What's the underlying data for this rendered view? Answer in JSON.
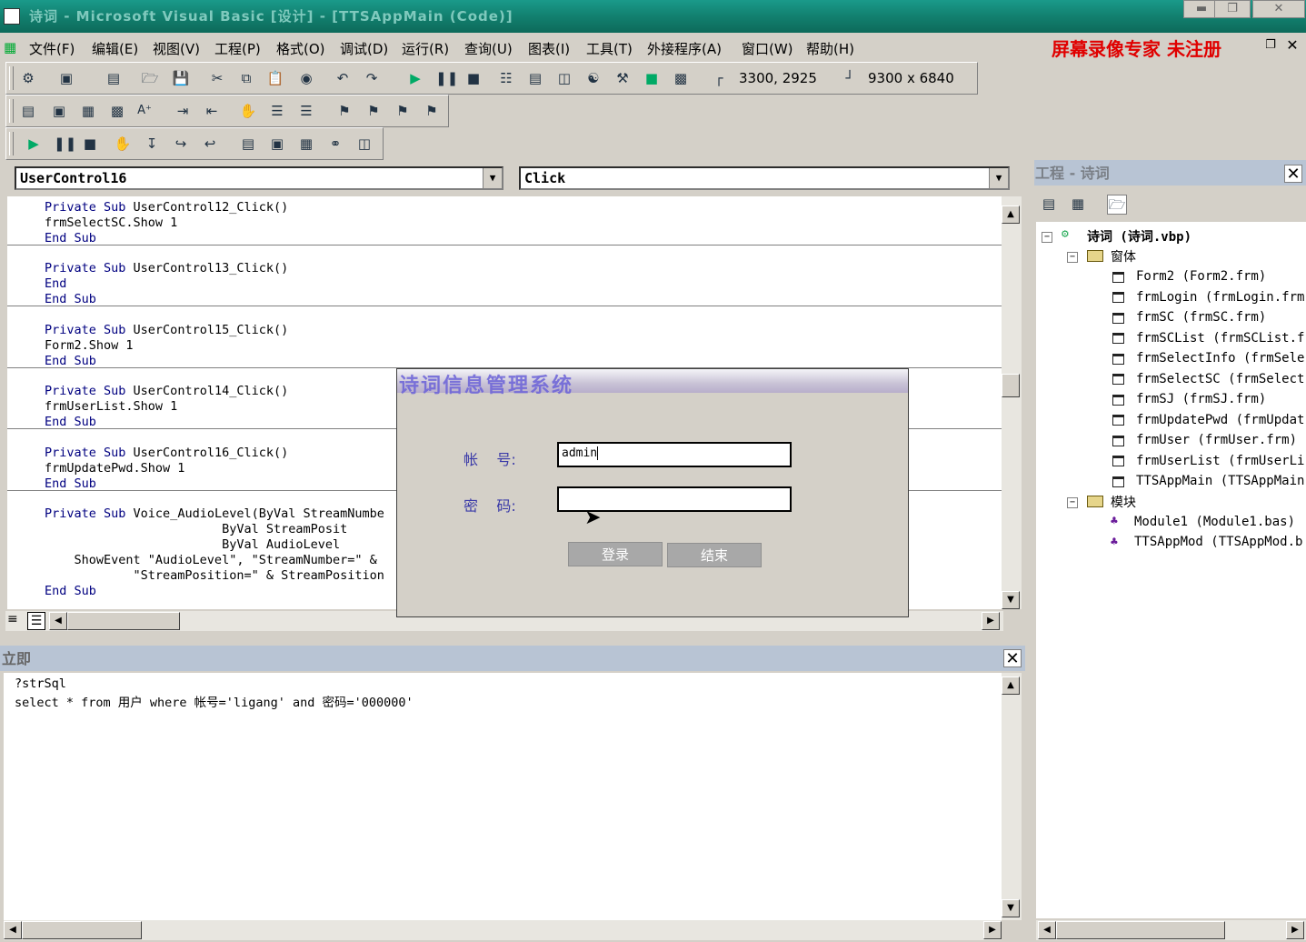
{
  "window": {
    "title": "诗词 - Microsoft Visual Basic [设计] - [TTSAppMain (Code)]",
    "min_icon": "minimize-icon",
    "max_icon": "restore-icon",
    "close_icon": "close-icon"
  },
  "menu": {
    "items": [
      "文件(F)",
      "编辑(E)",
      "视图(V)",
      "工程(P)",
      "格式(O)",
      "调试(D)",
      "运行(R)",
      "查询(U)",
      "图表(I)",
      "工具(T)",
      "外接程序(A)",
      "窗口(W)",
      "帮助(H)"
    ],
    "recorder_label": "屏幕录像专家  未注册"
  },
  "toolbar": {
    "position": "3300, 2925",
    "size": "9300 x 6840"
  },
  "code": {
    "object_combo": "UserControl16",
    "proc_combo": "Click",
    "lines": [
      [
        "Private Sub ",
        "UserControl12_Click()"
      ],
      [
        "",
        "frmSelectSC.Show 1"
      ],
      [
        "End Sub",
        ""
      ],
      [
        "Private Sub ",
        "UserControl13_Click()"
      ],
      [
        "End",
        ""
      ],
      [
        "End Sub",
        ""
      ],
      [
        "Private Sub ",
        "UserControl15_Click()"
      ],
      [
        "",
        "Form2.Show 1"
      ],
      [
        "End Sub",
        ""
      ],
      [
        "Private Sub ",
        "UserControl14_Click()"
      ],
      [
        "",
        "frmUserList.Show 1"
      ],
      [
        "End Sub",
        ""
      ],
      [
        "Private Sub ",
        "UserControl16_Click()"
      ],
      [
        "",
        "frmUpdatePwd.Show 1"
      ],
      [
        "End Sub",
        ""
      ],
      [
        "Private Sub ",
        "Voice_AudioLevel(ByVal StreamNumbe"
      ],
      [
        "",
        "                        ByVal StreamPosit"
      ],
      [
        "",
        "                        ByVal AudioLevel"
      ],
      [
        "",
        "    ShowEvent \"AudioLevel\", \"StreamNumber=\" &"
      ],
      [
        "",
        "            \"StreamPosition=\" & StreamPosition"
      ],
      [
        "End Sub",
        ""
      ]
    ]
  },
  "dialog": {
    "title": "诗词信息管理系统",
    "account_label": "帐    号:",
    "account_value": "admin",
    "password_label": "密    码:",
    "password_value": "",
    "login_button": "登录",
    "exit_button": "结束"
  },
  "immediate": {
    "title": "立即",
    "lines": [
      "?strSql",
      "select * from 用户 where 帐号='ligang' and 密码='000000'"
    ]
  },
  "project": {
    "title": "工程 - 诗词",
    "root": "诗词 (诗词.vbp)",
    "forms_folder": "窗体",
    "forms": [
      "Form2 (Form2.frm)",
      "frmLogin (frmLogin.frm",
      "frmSC (frmSC.frm)",
      "frmSCList (frmSCList.f",
      "frmSelectInfo (frmSele",
      "frmSelectSC (frmSelect",
      "frmSJ (frmSJ.frm)",
      "frmUpdatePwd (frmUpdat",
      "frmUser (frmUser.frm)",
      "frmUserList (frmUserLi",
      "TTSAppMain (TTSAppMain"
    ],
    "modules_folder": "模块",
    "modules": [
      "Module1 (Module1.bas)",
      "TTSAppMod (TTSAppMod.b"
    ]
  }
}
